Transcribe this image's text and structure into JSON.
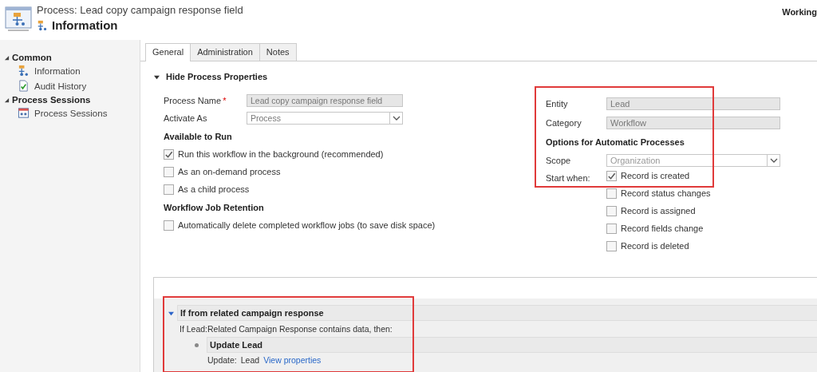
{
  "header": {
    "title": "Process: Lead copy campaign response field",
    "subtitle": "Information",
    "status": "Working"
  },
  "sidebar": {
    "groups": [
      {
        "label": "Common",
        "expanded": true,
        "items": [
          {
            "label": "Information",
            "kind": "process"
          },
          {
            "label": "Audit History",
            "kind": "audit"
          }
        ]
      },
      {
        "label": "Process Sessions",
        "expanded": true,
        "items": [
          {
            "label": "Process Sessions",
            "kind": "sessions"
          }
        ]
      }
    ]
  },
  "tabs": [
    {
      "label": "General",
      "selected": true
    },
    {
      "label": "Administration",
      "selected": false
    },
    {
      "label": "Notes",
      "selected": false
    }
  ],
  "section": {
    "label": "Hide Process Properties",
    "expanded": true
  },
  "process_name": {
    "label": "Process Name",
    "required_mark": "*",
    "value": "Lead copy campaign response field"
  },
  "activate_as": {
    "label": "Activate As",
    "value": "Process"
  },
  "available_to_run": {
    "heading": "Available to Run",
    "options": [
      {
        "label": "Run this workflow in the background (recommended)",
        "checked": true
      },
      {
        "label": "As an on-demand process",
        "checked": false
      },
      {
        "label": "As a child process",
        "checked": false
      }
    ]
  },
  "retention": {
    "heading": "Workflow Job Retention",
    "options": [
      {
        "label": "Automatically delete completed workflow jobs (to save disk space)",
        "checked": false
      }
    ]
  },
  "entity": {
    "label": "Entity",
    "value": "Lead"
  },
  "category": {
    "label": "Category",
    "value": "Workflow"
  },
  "automatic": {
    "heading": "Options for Automatic Processes",
    "scope": {
      "label": "Scope",
      "value": "Organization"
    },
    "start_when": {
      "label": "Start when:",
      "options": [
        {
          "label": "Record is created",
          "checked": true
        },
        {
          "label": "Record status changes",
          "checked": false
        },
        {
          "label": "Record is assigned",
          "checked": false
        },
        {
          "label": "Record fields change",
          "checked": false
        },
        {
          "label": "Record is deleted",
          "checked": false
        }
      ]
    }
  },
  "designer": {
    "step": {
      "title": "If from related campaign response",
      "expanded": true,
      "condition": "If Lead:Related Campaign Response contains data, then:",
      "action": {
        "title": "Update Lead",
        "prefix": "Update:",
        "entity": "Lead",
        "link": "View properties"
      }
    }
  }
}
